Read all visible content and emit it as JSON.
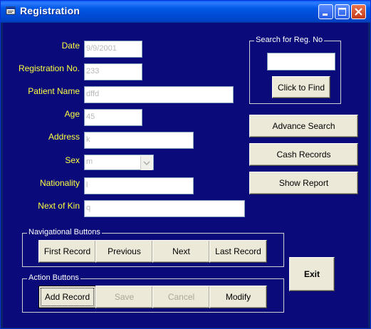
{
  "window": {
    "title": "Registration"
  },
  "form": {
    "date_label": "Date",
    "date_value": "9/9/2001",
    "regno_label": "Registration No.",
    "regno_value": "233",
    "patient_label": "Patient Name",
    "patient_value": "dffd",
    "age_label": "Age",
    "age_value": "45",
    "address_label": "Address",
    "address_value": "k",
    "sex_label": "Sex",
    "sex_value": "m",
    "nationality_label": "Nationality",
    "nationality_value": "l",
    "kin_label": "Next of Kin",
    "kin_value": "q"
  },
  "search": {
    "group_title": "Search for Reg. No",
    "input_value": "",
    "find_label": "Click to Find"
  },
  "side_buttons": {
    "advance": "Advance Search",
    "cash": "Cash Records",
    "report": "Show Report"
  },
  "nav": {
    "group_title": "Navigational Buttons",
    "first": "First Record",
    "previous": "Previous",
    "next": "Next",
    "last": "Last Record"
  },
  "action": {
    "group_title": "Action Buttons",
    "add": "Add Record",
    "save": "Save",
    "cancel": "Cancel",
    "modify": "Modify"
  },
  "exit_label": "Exit",
  "colors": {
    "background": "#0a0a7a",
    "label": "#ffff40",
    "titlebar": "#0058e6"
  },
  "icons": {
    "app": "form-icon",
    "minimize": "minimize-icon",
    "maximize": "maximize-icon",
    "close": "close-icon"
  }
}
